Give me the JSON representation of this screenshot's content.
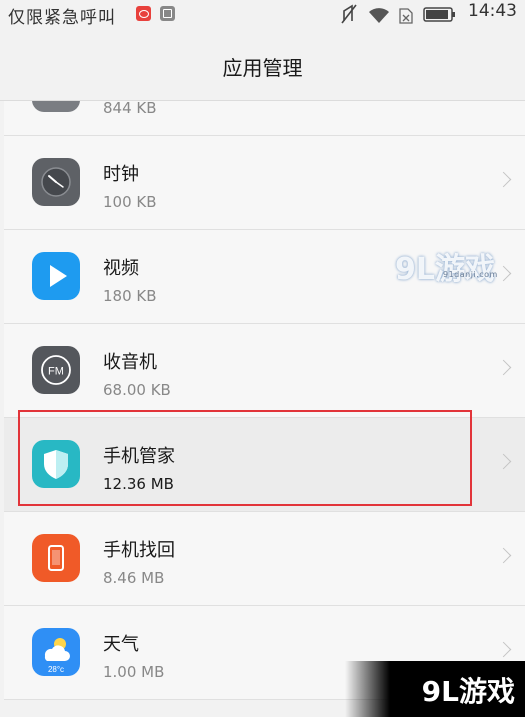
{
  "status_bar": {
    "carrier": "仅限紧急呼叫",
    "time": "14:43",
    "icons": [
      "weibo-icon",
      "gallery-icon",
      "mute-icon",
      "wifi-icon",
      "no-sim-icon",
      "battery-icon"
    ]
  },
  "header": {
    "title": "应用管理"
  },
  "apps": [
    {
      "name": "",
      "size": "844 KB",
      "icon": "partial-app-icon",
      "color": "#7a7d82"
    },
    {
      "name": "时钟",
      "size": "100 KB",
      "icon": "clock-icon",
      "color": "#5e6166"
    },
    {
      "name": "视频",
      "size": "180 KB",
      "icon": "video-play-icon",
      "color": "#1e9bf0"
    },
    {
      "name": "收音机",
      "size": "68.00 KB",
      "icon": "fm-radio-icon",
      "color": "#54575c"
    },
    {
      "name": "手机管家",
      "size": "12.36 MB",
      "icon": "phone-manager-shield-icon",
      "color": "#28b8c4"
    },
    {
      "name": "手机找回",
      "size": "8.46 MB",
      "icon": "find-phone-icon",
      "color": "#f05a28"
    },
    {
      "name": "天气",
      "size": "1.00 MB",
      "icon": "weather-icon",
      "color": "#2f8ff5"
    }
  ],
  "weather_icon_text": "28°c",
  "highlight_color": "#e2343a",
  "watermark": {
    "main": "9L游戏",
    "sub": "91danji.com",
    "corner": "9L游戏"
  }
}
